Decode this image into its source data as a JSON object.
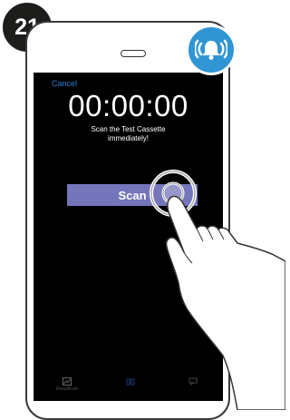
{
  "step": {
    "number": "21"
  },
  "alarm": {
    "icon": "bell-ringing-icon",
    "color": "#2f96d3"
  },
  "screen": {
    "cancel_label": "Cancel",
    "timer": "00:00:00",
    "instruction_line1": "Scan the Test Cassette",
    "instruction_line2": "immediately!",
    "scan_label": "Scan",
    "scan_color": "#7575bb"
  },
  "tabbar": {
    "items": [
      {
        "label": "Results-en",
        "icon": "chart-icon"
      },
      {
        "label": "",
        "icon": "camera-icon"
      },
      {
        "label": "",
        "icon": "chat-icon"
      }
    ]
  }
}
